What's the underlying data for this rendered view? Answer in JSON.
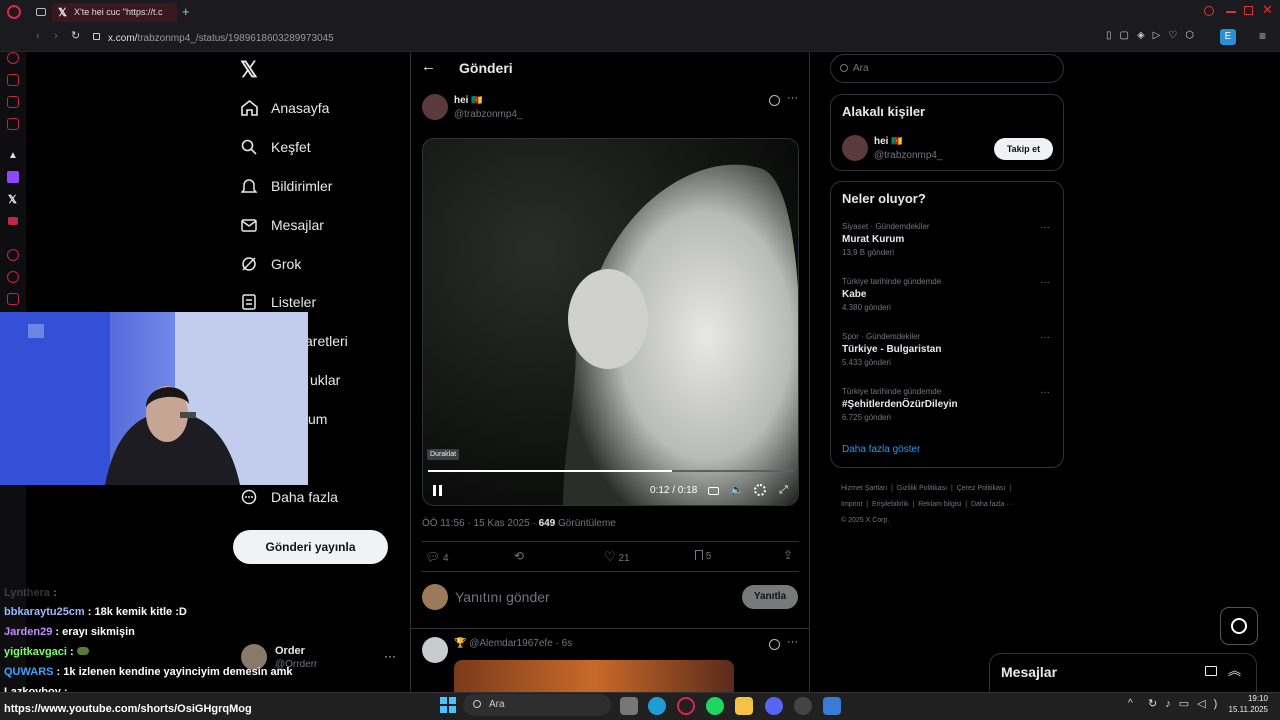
{
  "browser": {
    "tab_title": "X'te hei cuc \"https://t.c",
    "url_prefix": "x.com/",
    "url_path": "trabzonmp4_/status/1989618603289973045"
  },
  "nav": {
    "items": [
      "Anasayfa",
      "Keşfet",
      "Bildirimler",
      "Mesajlar",
      "Grok",
      "Listeler",
      "aretleri",
      "uklar",
      "um",
      "Daha fazla"
    ],
    "post_button": "Gönderi yayınla",
    "profile_name": "Order",
    "profile_handle": "@Orrderr"
  },
  "post": {
    "header_title": "Gönderi",
    "author_name": "hei",
    "author_flag": "🇨🇲",
    "author_handle": "@trabzonmp4_",
    "tooltip": "Duraklat",
    "progress": 0.667,
    "time_display": "0:12 / 0:18",
    "timestamp": "ÖÖ 11:56 · 15 Kas 2025 · ",
    "views_count": "649",
    "views_label": " Görüntüleme",
    "replies": "4",
    "likes": "21",
    "bookmarks": "5",
    "reply_placeholder": "Yanıtını gönder",
    "reply_button": "Yanıtla",
    "reply_author_handle": "@Alemdar1967efe",
    "reply_time": "· 6s"
  },
  "right": {
    "search_placeholder": "Ara",
    "related_title": "Alakalı kişiler",
    "related_name": "hei",
    "related_handle": "@trabzonmp4_",
    "follow_label": "Takip et",
    "trends_title": "Neler oluyor?",
    "trends": [
      {
        "category": "Siyaset · Gündemdekiler",
        "title": "Murat Kurum",
        "count": "13,9 B gönderi"
      },
      {
        "category": "Türkiye tarihinde gündemde",
        "title": "Kabe",
        "count": "4.380 gönderi"
      },
      {
        "category": "Spor · Gündemdekiler",
        "title": "Türkiye - Bulgaristan",
        "count": "5.433 gönderi"
      },
      {
        "category": "Türkiye tarihinde gündemde",
        "title": "#ŞehitlerdenÖzürDileyin",
        "count": "6.725 gönderi"
      }
    ],
    "show_more": "Daha fazla göster",
    "footer_line1": [
      "Hizmet Şartları",
      "Gizlilik Politikası",
      "Çerez Politikası"
    ],
    "footer_line2": [
      "Imprint",
      "Erişilebilirlik",
      "Reklam bilgisi",
      "Daha fazla ···"
    ],
    "copyright": "© 2025 X Corp.",
    "messages_title": "Mesajlar"
  },
  "chat": [
    {
      "user": "Lynthera",
      "text": " : ",
      "color": "#777777"
    },
    {
      "user": "bbkaraytu25cm",
      "text": " : 18k kemik kitle :D",
      "color": "#9bb7ff"
    },
    {
      "user": "Jarden29",
      "text": " : erayı sikmişin",
      "color": "#c98bff"
    },
    {
      "user": "yigitkavgaci",
      "text": " : ",
      "color": "#7dff6a"
    },
    {
      "user": "QUWARS",
      "text": " : 1k izlenen kendine yayinciyim demesin amk",
      "color": "#3da1ff"
    },
    {
      "user": "Lazkoyboy",
      "text": " :",
      "color": "#ffffff"
    },
    {
      "user": "",
      "text": "https://www.youtube.com/shorts/OsiGHgrqMog",
      "color": "#ffffff"
    }
  ],
  "taskbar": {
    "search": "Ara",
    "time": "19:10",
    "date": "15.11.2025"
  }
}
